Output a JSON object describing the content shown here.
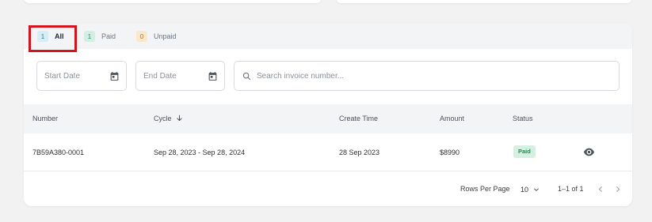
{
  "tabs": [
    {
      "count": "1",
      "label": "All"
    },
    {
      "count": "1",
      "label": "Paid"
    },
    {
      "count": "0",
      "label": "Unpaid"
    }
  ],
  "filters": {
    "start_date_placeholder": "Start Date",
    "end_date_placeholder": "End Date",
    "search_placeholder": "Search invoice number..."
  },
  "table": {
    "headers": {
      "number": "Number",
      "cycle": "Cycle",
      "create_time": "Create Time",
      "amount": "Amount",
      "status": "Status"
    },
    "rows": [
      {
        "number": "7B59A380-0001",
        "cycle": "Sep 28, 2023 - Sep 28, 2024",
        "create_time": "28 Sep 2023",
        "amount": "$8990",
        "status": "Paid"
      }
    ]
  },
  "pagination": {
    "rows_per_page_label": "Rows Per Page",
    "rows_per_page_value": "10",
    "range": "1–1 of 1"
  },
  "colors": {
    "highlight": "#d4141c",
    "paid_badge_bg": "#d5f0e1",
    "paid_badge_text": "#218a51"
  },
  "icons": [
    "calendar-icon",
    "search-icon",
    "sort-arrow-down-icon",
    "eye-icon",
    "chevron-down-icon",
    "chevron-left-icon",
    "chevron-right-icon"
  ]
}
